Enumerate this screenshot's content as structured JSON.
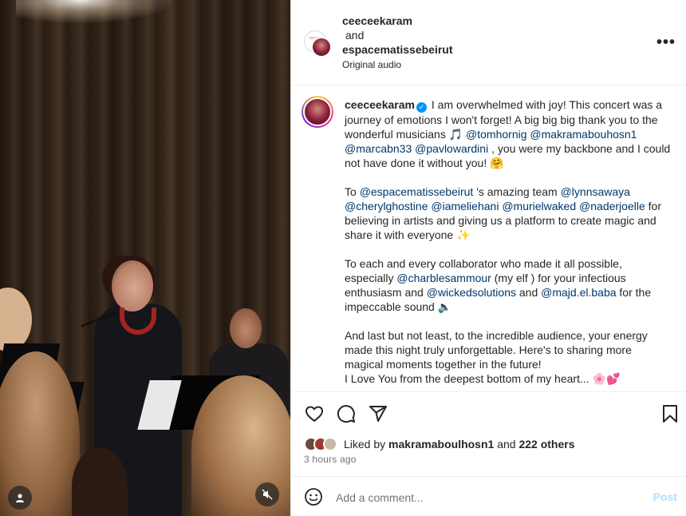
{
  "header": {
    "user1": "ceeceekaram",
    "conjunction": "and",
    "user2": "espacematissebeirut",
    "audio": "Original audio",
    "avatar_badge": "ceecee",
    "more_label": "•••"
  },
  "caption": {
    "username": "ceeceekaram",
    "p1": [
      {
        "t": "text",
        "v": " I am overwhelmed with joy! This concert was a journey of emotions I won't forget! A big big big thank you to the wonderful musicians 🎵 "
      },
      {
        "t": "mention",
        "v": "@tomhornig"
      },
      {
        "t": "text",
        "v": " "
      },
      {
        "t": "mention",
        "v": "@makramabouhosn1"
      },
      {
        "t": "text",
        "v": " "
      },
      {
        "t": "mention",
        "v": "@marcabn33"
      },
      {
        "t": "text",
        "v": " "
      },
      {
        "t": "mention",
        "v": "@pavlowardini"
      },
      {
        "t": "text",
        "v": " , you were my backbone and I could not have done it without you! 🤗"
      }
    ],
    "p2": [
      {
        "t": "text",
        "v": "To "
      },
      {
        "t": "mention",
        "v": "@espacematissebeirut"
      },
      {
        "t": "text",
        "v": " 's amazing team "
      },
      {
        "t": "mention",
        "v": "@lynnsawaya"
      },
      {
        "t": "text",
        "v": " "
      },
      {
        "t": "mention",
        "v": "@cherylghostine"
      },
      {
        "t": "text",
        "v": " "
      },
      {
        "t": "mention",
        "v": "@iameliehani"
      },
      {
        "t": "text",
        "v": " "
      },
      {
        "t": "mention",
        "v": "@murielwaked"
      },
      {
        "t": "text",
        "v": " "
      },
      {
        "t": "mention",
        "v": "@naderjoelle"
      },
      {
        "t": "text",
        "v": " for believing in artists and giving us a platform to create magic and share it with everyone ✨"
      }
    ],
    "p3": [
      {
        "t": "text",
        "v": "To each and every collaborator who made it all possible, especially "
      },
      {
        "t": "mention",
        "v": "@charblesammour"
      },
      {
        "t": "text",
        "v": " (my elf ) for your infectious enthusiasm and "
      },
      {
        "t": "mention",
        "v": "@wickedsolutions"
      },
      {
        "t": "text",
        "v": " and "
      },
      {
        "t": "mention",
        "v": "@majd.el.baba"
      },
      {
        "t": "text",
        "v": " for the impeccable sound 🔈"
      }
    ],
    "p4": [
      {
        "t": "text",
        "v": "And last but not least, to the incredible audience, your energy made this night truly unforgettable. Here's to sharing more magical moments together in the future!"
      },
      {
        "t": "br",
        "v": ""
      },
      {
        "t": "text",
        "v": "I Love You from the deepest bottom of my heart... 🌸💕"
      }
    ]
  },
  "actions": {
    "icons": [
      "heart-icon",
      "comment-icon",
      "share-icon",
      "bookmark-icon"
    ]
  },
  "likes": {
    "prefix": "Liked by",
    "user": "makramaboulhosn1",
    "middle": "and",
    "others": "222 others"
  },
  "time": "3 hours ago",
  "comment": {
    "placeholder": "Add a comment...",
    "post_label": "Post"
  },
  "colors": {
    "mention": "#00376b",
    "verified": "#0095f6",
    "post_disabled": "#b2dffc"
  }
}
